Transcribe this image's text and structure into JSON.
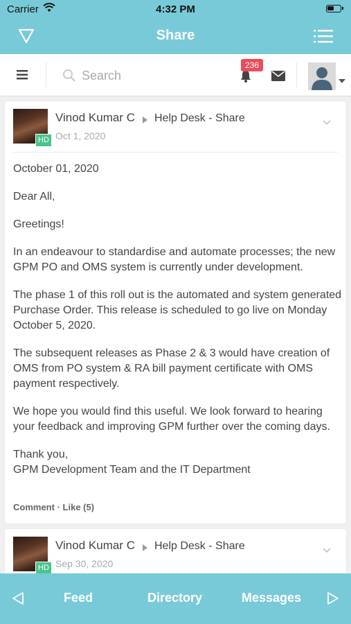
{
  "status_bar": {
    "carrier": "Carrier",
    "time": "4:32 PM"
  },
  "nav": {
    "title": "Share",
    "left_icon": "filter-icon",
    "right_icon": "list-icon"
  },
  "toolbar": {
    "search_placeholder": "Search",
    "notification_count": "236"
  },
  "posts": [
    {
      "author": "Vinod Kumar C",
      "group": "Help Desk - Share",
      "badge": "HD",
      "date": "Oct 1, 2020",
      "paragraphs": [
        "October 01, 2020",
        "Dear All,",
        "Greetings!",
        "In an endeavour to standardise and automate processes; the new GPM PO and OMS system is currently under development.",
        "The phase 1 of this roll out is the automated and system generated Purchase Order. This release is scheduled to go live on Monday October 5, 2020.",
        "The subsequent releases as Phase 2 & 3 would have creation of OMS from PO system & RA bill payment certificate with OMS payment respectively.",
        "We hope you would find this useful. We look forward to hearing your feedback and improving GPM further over the coming days.",
        "Thank you,",
        "GPM Development Team and the IT Department"
      ],
      "comment_label": "Comment",
      "like_label": "Like (5)"
    },
    {
      "author": "Vinod Kumar C",
      "group": "Help Desk - Share",
      "badge": "HD",
      "date": "Sep 30, 2020"
    }
  ],
  "tabs": {
    "feed": "Feed",
    "directory": "Directory",
    "messages": "Messages"
  },
  "colors": {
    "accent": "#79cad8",
    "badge_red": "#ec4b5c",
    "hd_green": "#4ac48b"
  }
}
